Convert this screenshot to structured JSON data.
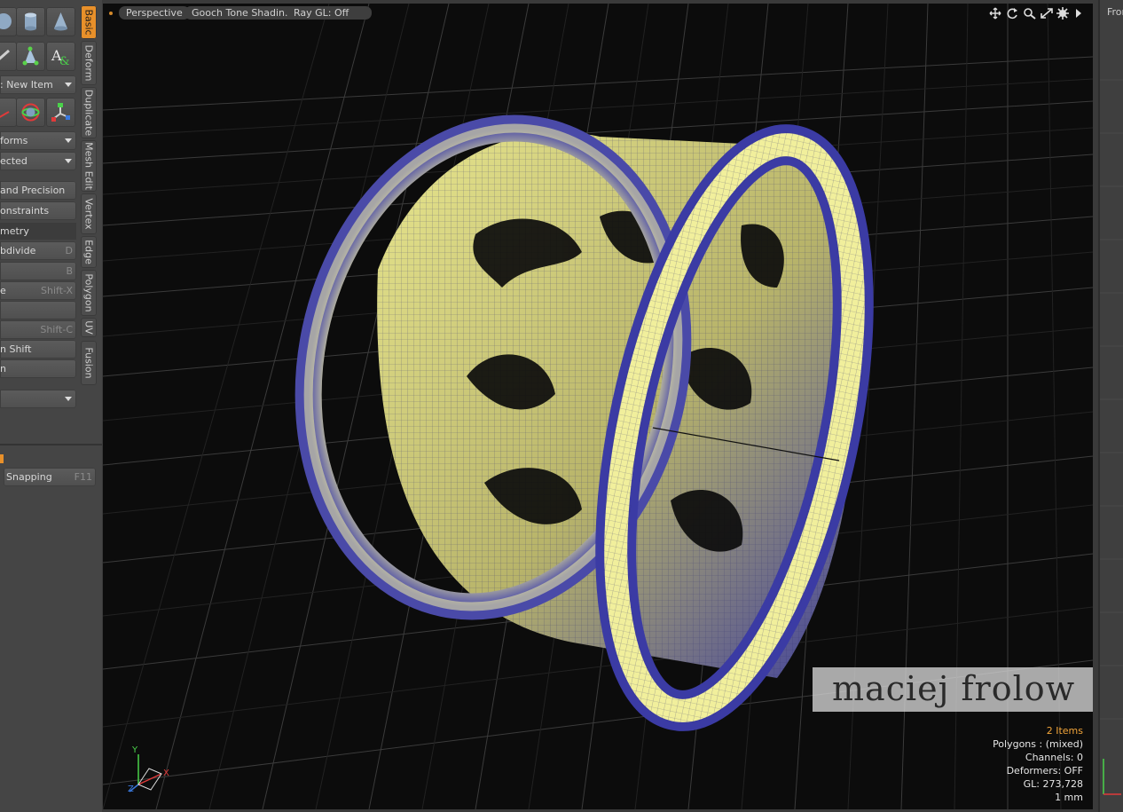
{
  "left_panel": {
    "new_item": ": New Item",
    "transforms": "forms",
    "selected": "ected",
    "snap_precision": "and Precision",
    "constraints": "onstraints",
    "geometry_header": "metry",
    "subdivide": "bdivide",
    "subdivide_hotkey": "D",
    "b_hotkey": "B",
    "item_e": "e",
    "shift_x": "Shift-X",
    "shift_c": "Shift-C",
    "n_shift": "n Shift",
    "item_n": "n",
    "snapping": "Snapping",
    "snapping_hotkey": "F11"
  },
  "tabs": [
    "Basic",
    "Deform",
    "Duplicate",
    "Mesh Edit",
    "Vertex",
    "Edge",
    "Polygon",
    "UV",
    "Fusion"
  ],
  "viewport": {
    "view": "Perspective",
    "shading": "Gooch Tone Shadin...",
    "raygl": "Ray GL: Off",
    "nav_icons": [
      "move-icon",
      "rotate-icon",
      "zoom-icon",
      "maximize-icon",
      "settings-icon",
      "expand-icon"
    ]
  },
  "info": {
    "items": "2 Items",
    "polygons": "Polygons : (mixed)",
    "channels": "Channels: 0",
    "deformers": "Deformers: OFF",
    "gl": "GL: 273,728",
    "unit": "1 mm"
  },
  "axes": {
    "y": "Y",
    "x": "X",
    "z": "Z"
  },
  "watermark": "maciej frolow",
  "right_panel": {
    "title": "Fron"
  },
  "colors": {
    "accent": "#e8902a",
    "mesh_light": "#f0ee9a",
    "mesh_dark": "#3a3aa0",
    "viewport_bg": "#0c0c0c"
  }
}
